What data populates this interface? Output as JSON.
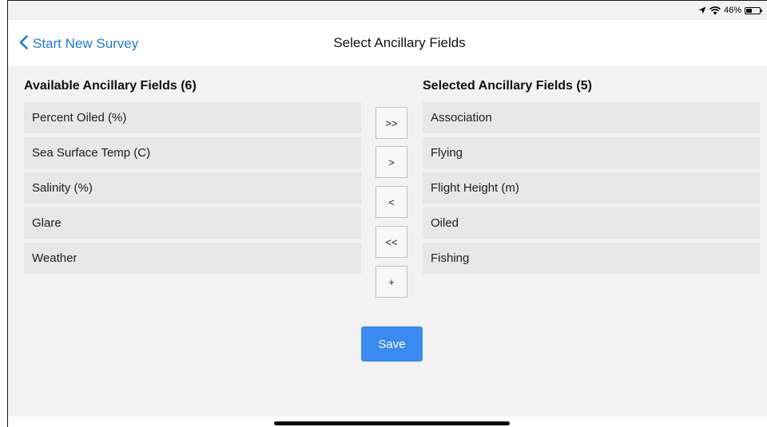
{
  "status": {
    "battery_text": "46%",
    "battery_level": 0.46,
    "icons": [
      "location-arrow-icon",
      "wifi-icon",
      "battery-icon"
    ]
  },
  "nav": {
    "back_label": "Start New Survey",
    "title": "Select Ancillary Fields"
  },
  "available": {
    "title": "Available Ancillary Fields (6)",
    "items": [
      "Percent Oiled (%)",
      "Sea Surface Temp (C)",
      "Salinity (%)",
      "Glare",
      "Weather"
    ]
  },
  "selected": {
    "title": "Selected Ancillary Fields (5)",
    "items": [
      "Association",
      "Flying",
      "Flight Height (m)",
      "Oiled",
      "Fishing"
    ]
  },
  "controls": {
    "move_all_right": ">>",
    "move_right": ">",
    "move_left": "<",
    "move_all_left": "<<",
    "add": "+"
  },
  "save_label": "Save",
  "colors": {
    "accent": "#1e7bd9",
    "save_button": "#3a8af0",
    "background": "#f2f2f2",
    "row": "#e7e7e7"
  }
}
